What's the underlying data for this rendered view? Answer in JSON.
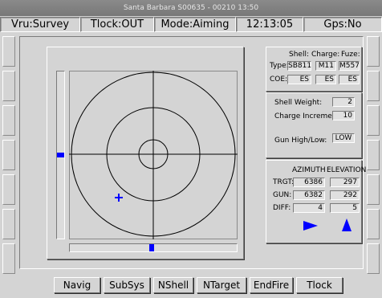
{
  "window": {
    "title": "Santa Barbara  S00635 - 00210 13:50"
  },
  "status": {
    "vru": "Vru:Survey",
    "tlock": "Tlock:OUT",
    "mode": "Mode:Aiming",
    "time": "12:13:05",
    "gps": "Gps:No"
  },
  "ammo": {
    "headers": {
      "shell": "Shell:",
      "charge": "Charge:",
      "fuze": "Fuze:"
    },
    "type_label": "Type:",
    "type_values": [
      "SB811",
      "M11",
      "M557"
    ],
    "coe_label": "COE:",
    "coe_values": [
      "ES",
      "ES",
      "ES"
    ]
  },
  "settings": {
    "shell_weight_label": "Shell Weight:",
    "shell_weight_value": "2",
    "charge_increment_label": "Charge Increment:",
    "charge_increment_value": "10",
    "gun_label": "Gun High/Low:",
    "gun_value": "LOW"
  },
  "aim": {
    "azimuth_header": "AZIMUTH",
    "elevation_header": "ELEVATION",
    "rows": [
      {
        "label": "TRGT:",
        "azimuth": "6386",
        "elevation": "297"
      },
      {
        "label": "GUN:",
        "azimuth": "6382",
        "elevation": "292"
      },
      {
        "label": "DIFF:",
        "azimuth": "4",
        "elevation": "5"
      }
    ]
  },
  "colors": {
    "indicator": "#0000ff",
    "background": "#d4d4d4"
  },
  "icons": {
    "azimuth_direction": "arrow-right-icon",
    "elevation_direction": "arrow-up-icon",
    "crosshair": "target-crosshair-icon"
  },
  "buttons": {
    "navig": "Navig",
    "subsys": "SubSys",
    "nshell": "NShell",
    "ntarget": "NTarget",
    "endfire": "EndFire",
    "tlock": "Tlock"
  }
}
